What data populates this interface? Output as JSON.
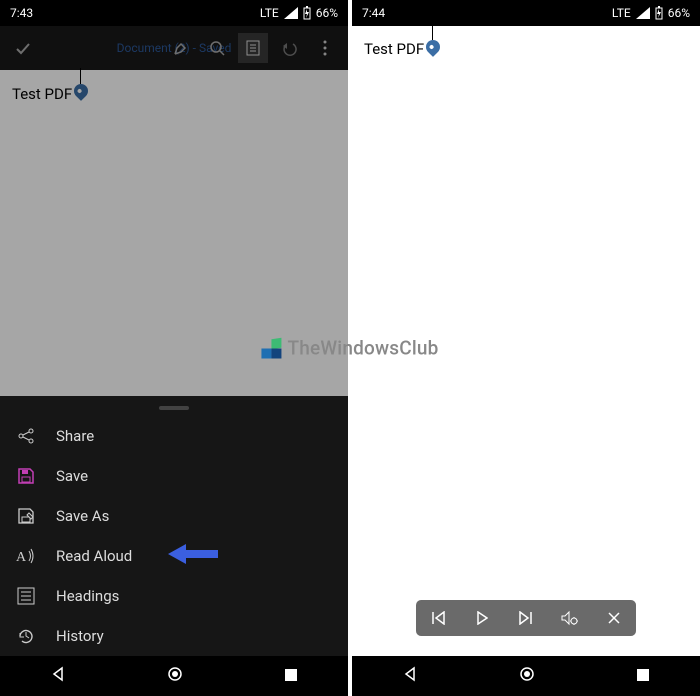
{
  "left": {
    "status": {
      "time": "7:43",
      "network": "LTE",
      "battery": "66%"
    },
    "app_title": "Document (2) - Saved",
    "document_text": "Test PDF",
    "menu": {
      "items": [
        {
          "label": "Share",
          "icon": "share-icon"
        },
        {
          "label": "Save",
          "icon": "save-icon"
        },
        {
          "label": "Save As",
          "icon": "saveas-icon"
        },
        {
          "label": "Read Aloud",
          "icon": "read-aloud-icon",
          "highlighted": true
        },
        {
          "label": "Headings",
          "icon": "headings-icon"
        },
        {
          "label": "History",
          "icon": "history-icon"
        }
      ]
    }
  },
  "right": {
    "status": {
      "time": "7:44",
      "network": "LTE",
      "battery": "66%"
    },
    "document_text": "Test PDF"
  },
  "watermark": "TheWindowsClub"
}
